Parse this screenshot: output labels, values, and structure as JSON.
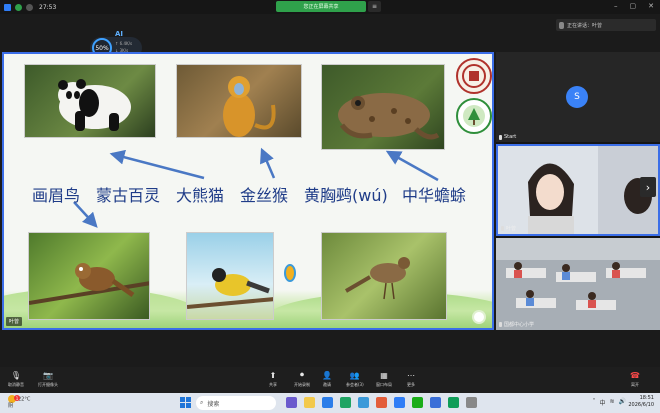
{
  "topbar": {
    "timer": "27:53",
    "sharing_text": "您正在屏幕共享",
    "menu_icon": "≡"
  },
  "speaker": {
    "text": "正在讲话：叶曾"
  },
  "ai": {
    "label": "AI",
    "percent": "50%",
    "stat1": "↑ 6.4K/s",
    "stat2": "↓ 3K/s"
  },
  "slide": {
    "captions": [
      "画眉鸟",
      "蒙古百灵",
      "大熊猫",
      "金丝猴",
      "黄胸鹀(wú)",
      "中华蟾蜍"
    ],
    "presenter_tag": "叶曾"
  },
  "participants": [
    {
      "label": "Start",
      "initial": "S"
    },
    {
      "label": "叶曾"
    },
    {
      "label": "国都中心小学"
    }
  ],
  "toolbar": {
    "left": [
      {
        "label": "取消静音",
        "icon": "mic-off-icon"
      },
      {
        "label": "打开摄像头",
        "icon": "camera-off-icon"
      }
    ],
    "center": [
      {
        "label": "共享",
        "icon": "share-icon"
      },
      {
        "label": "开始录制",
        "icon": "record-icon"
      },
      {
        "label": "邀请",
        "icon": "invite-icon"
      },
      {
        "label": "参会者(3)",
        "icon": "participants-icon"
      },
      {
        "label": "窗口布局",
        "icon": "layout-icon"
      },
      {
        "label": "更多",
        "icon": "more-icon"
      }
    ],
    "leave_label": "离开"
  },
  "taskbar": {
    "weather_temp": "22°C",
    "weather_desc": "阴",
    "search_placeholder": "搜索",
    "time": "18:51",
    "date": "2026/6/10",
    "notification_count": "1"
  },
  "colors": {
    "accent": "#3b6ee8",
    "caption": "#1f3c88",
    "sharing": "#2fa14b",
    "leave": "#ff4a4a"
  }
}
